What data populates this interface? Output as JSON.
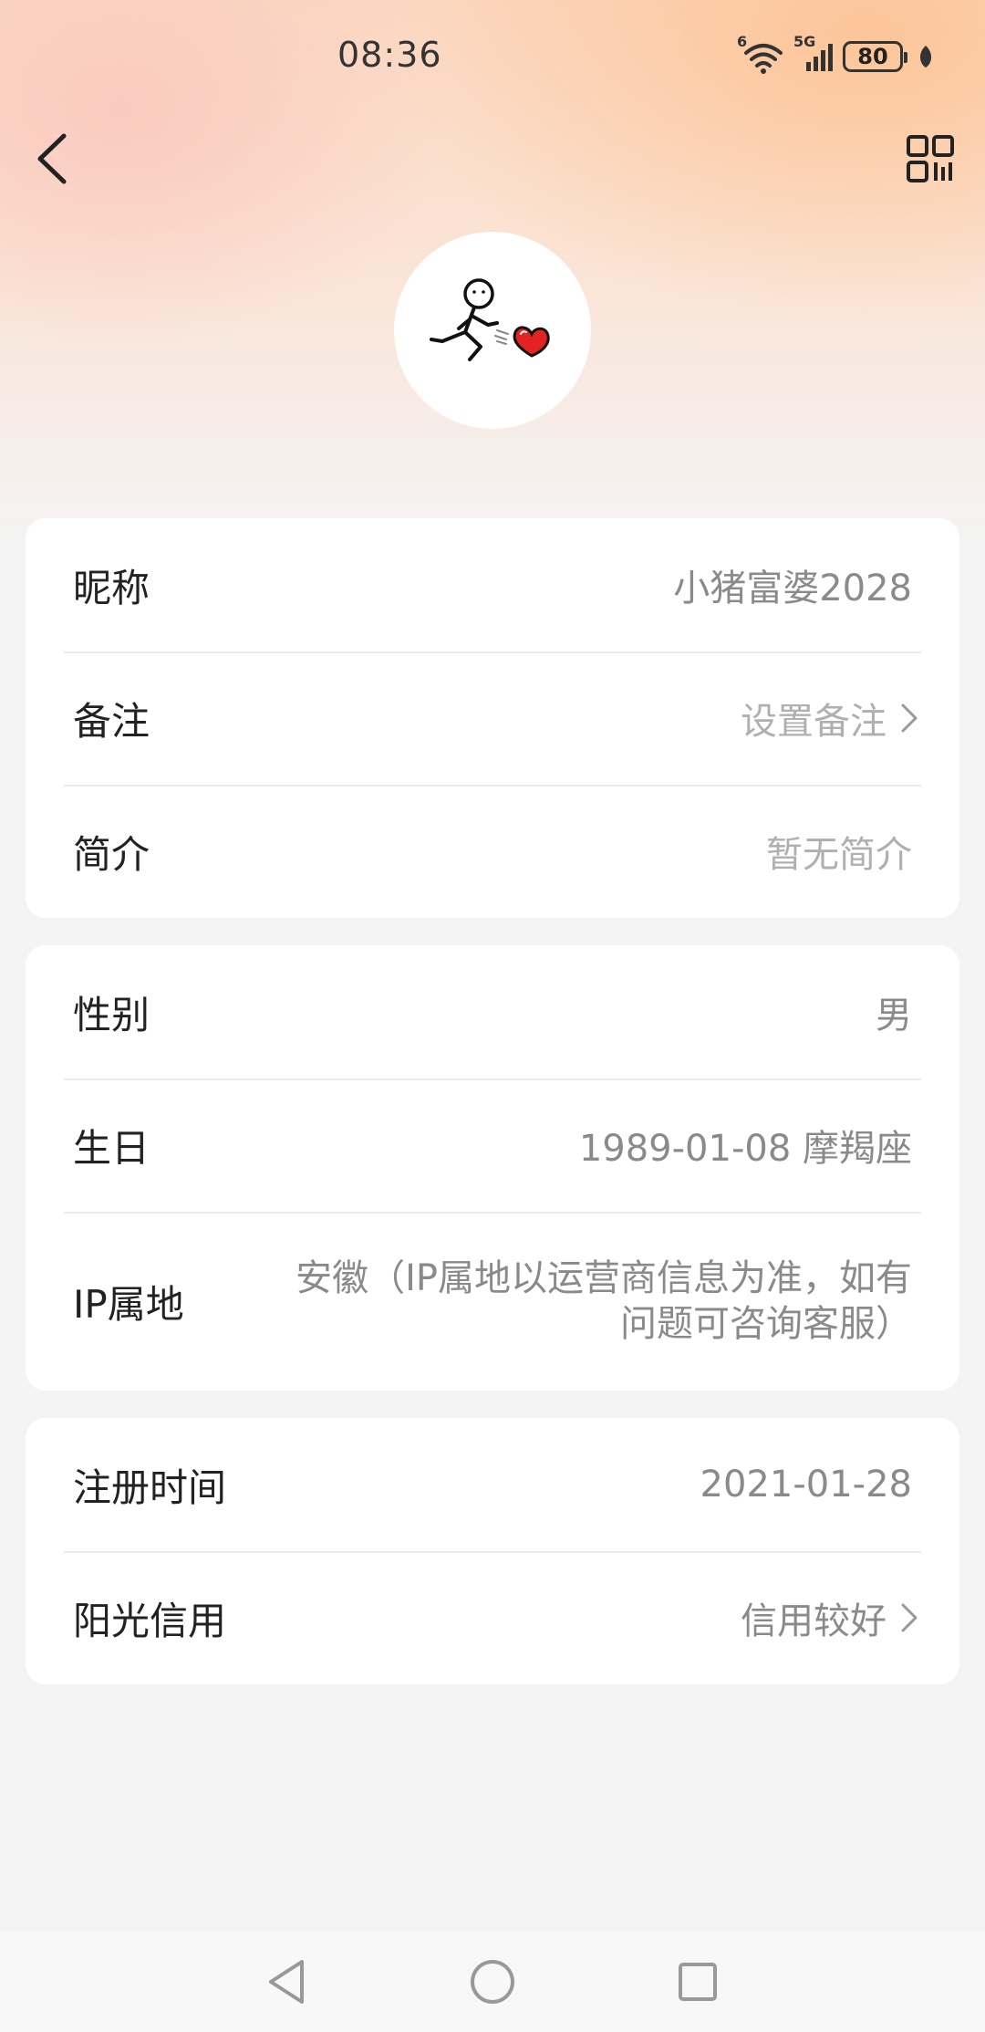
{
  "status_bar": {
    "time": "08:36",
    "wifi_badge": "6",
    "network": "5G",
    "battery": "80",
    "icons": [
      "wifi-icon",
      "signal-icon",
      "battery-icon",
      "leaf-icon"
    ]
  },
  "header": {
    "back_icon": "chevron-left-icon",
    "qr_icon": "qr-code-icon"
  },
  "profile": {
    "avatar_icon": "stick-figure-heart-avatar"
  },
  "card1": [
    {
      "label": "昵称",
      "value": "小猪富婆2028"
    },
    {
      "label": "备注",
      "value": "设置备注"
    },
    {
      "label": "简介",
      "value": "暂无简介"
    }
  ],
  "card2": [
    {
      "label": "性别",
      "value": "男"
    },
    {
      "label": "生日",
      "value": "1989-01-08 摩羯座"
    },
    {
      "label": "IP属地",
      "value": "安徽（IP属地以运营商信息为准，如有问题可咨询客服）"
    }
  ],
  "card3": [
    {
      "label": "注册时间",
      "value": "2021-01-28"
    },
    {
      "label": "阳光信用",
      "value": "信用较好"
    }
  ],
  "colors": {
    "page_bg": "#f4f4f4",
    "card_bg": "#ffffff",
    "value_text": "#8a8a8a",
    "placeholder_text": "#b0b0b0",
    "heart": "#e32222"
  }
}
